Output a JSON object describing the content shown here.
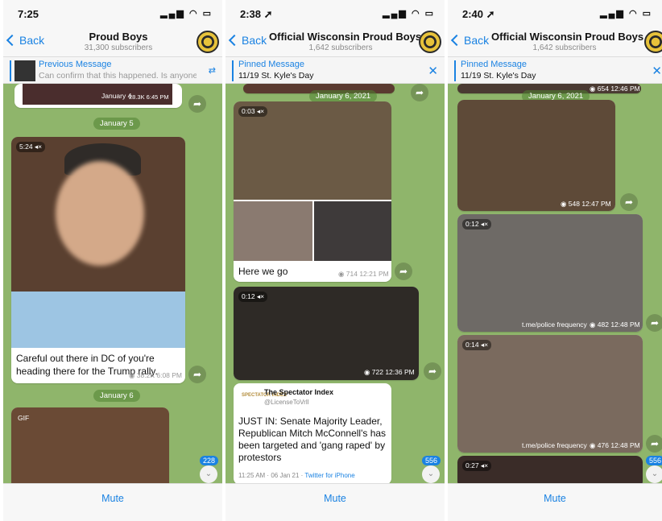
{
  "phones": [
    {
      "time": "7:25",
      "channel_title": "Proud Boys",
      "subscribers": "31,300 subscribers",
      "back": "Back",
      "pinned_label": "Previous Message",
      "pinned_text": "Can confirm that this happened.  Is anyone...",
      "date_pills": [
        "January 5",
        "January 6"
      ],
      "top_meta": "January 4",
      "top_views": "28.3K 6:45 PM",
      "video_duration": "5:24",
      "caption": "Careful out there in DC of you're heading there for the Trump rally.",
      "caption_meta": "38.2K 6:08 PM",
      "gif_label": "GIF",
      "unread_count": "228",
      "mute": "Mute"
    },
    {
      "time": "2:38",
      "channel_title": "Official Wisconsin Proud Boys",
      "subscribers": "1,642 subscribers",
      "back": "Back",
      "pinned_label": "Pinned Message",
      "pinned_text": "11/19 St. Kyle's Day",
      "date_pill": "January 6, 2021",
      "video1_duration": "0:03",
      "caption": "Here we go",
      "caption_meta": "714 12:21 PM",
      "video2_duration": "0:12",
      "video2_meta": "722 12:36 PM",
      "tweet_logo": "SPECTATOR INDEX",
      "tweet_name": "The Spectator Index",
      "tweet_handle": "@LicenseToVrll",
      "tweet_text": "JUST IN: Senate Majority Leader, Republican Mitch McConnell's has been targeted and 'gang raped' by protestors",
      "tweet_footer_time": "11:25 AM · 06 Jan 21 · ",
      "tweet_footer_source": "Twitter for iPhone",
      "unread_count": "556",
      "mute": "Mute"
    },
    {
      "time": "2:40",
      "channel_title": "Official Wisconsin Proud Boys",
      "subscribers": "1,642 subscribers",
      "back": "Back",
      "pinned_label": "Pinned Message",
      "pinned_text": "11/19 St. Kyle's Day",
      "date_pill": "January 6, 2021",
      "top_meta": "654 12:46 PM",
      "video1_meta": "548 12:47 PM",
      "video2_duration": "0:12",
      "video2_meta": "482 12:48 PM",
      "video2_watermark": "t.me/police frequency",
      "video3_duration": "0:14",
      "video3_meta": "476 12:48 PM",
      "video3_watermark": "t.me/police frequency",
      "video4_duration": "0:27",
      "unread_count": "556",
      "mute": "Mute"
    }
  ],
  "colors": {
    "accent": "#1a82e2",
    "chat_bg": "#8fb56b"
  }
}
